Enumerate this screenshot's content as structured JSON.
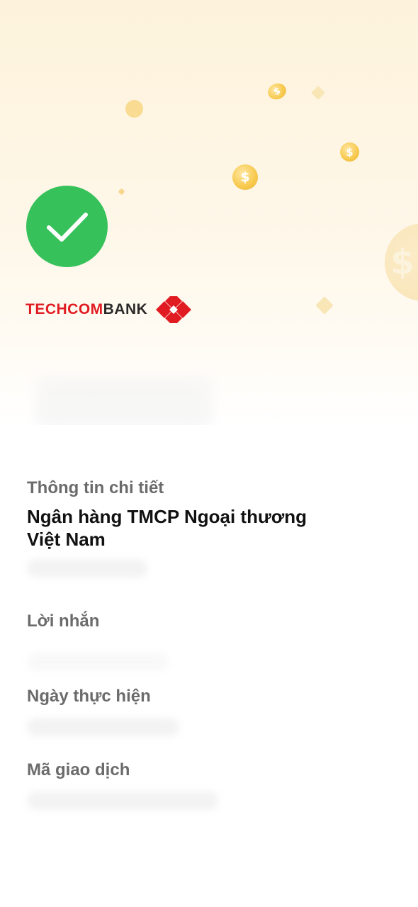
{
  "brand": {
    "name_part1": "TECHCOM",
    "name_part2": "BANK",
    "primary_color": "#e11b22",
    "dark_color": "#2a2a2a"
  },
  "status": {
    "icon": "checkmark-icon",
    "color": "#36c15a"
  },
  "details": {
    "section_title": "Thông tin chi tiết",
    "bank_name_line1": "Ngân hàng TMCP Ngoại thương",
    "bank_name_line2": "Việt Nam",
    "message_label": "Lời nhắn",
    "date_label": "Ngày thực hiện",
    "transaction_id_label": "Mã giao dịch"
  },
  "decor": {
    "coin_symbol": "$"
  }
}
